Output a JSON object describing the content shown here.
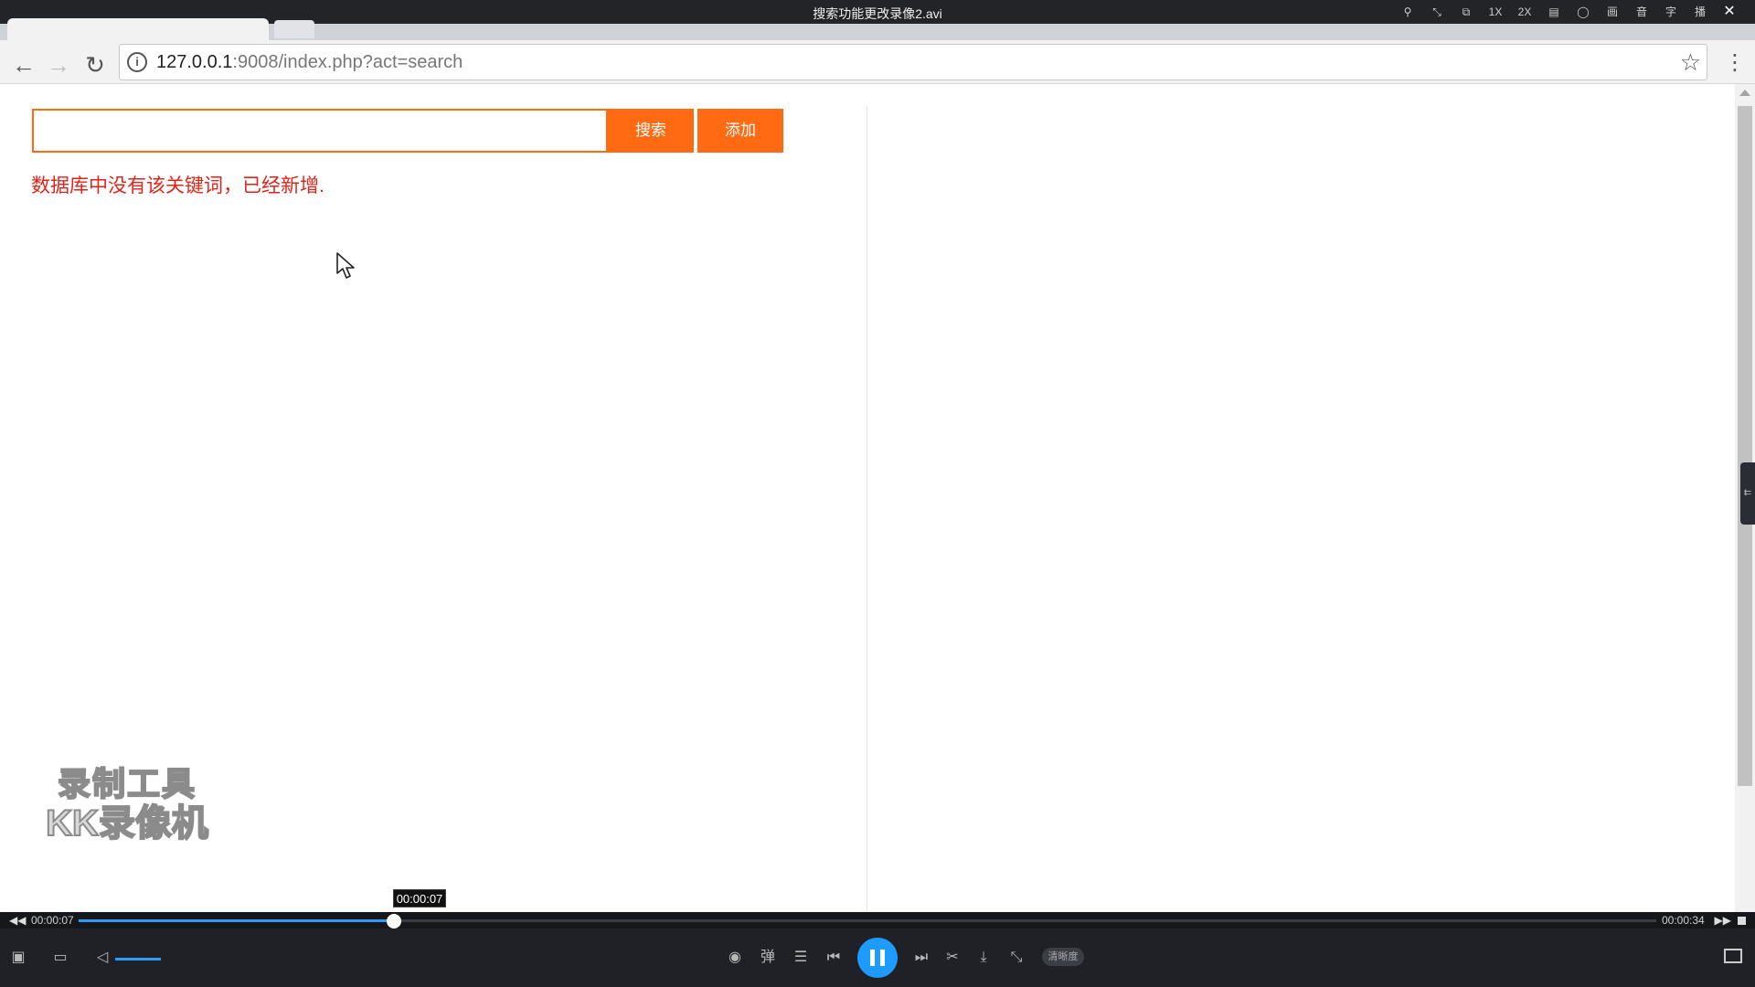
{
  "player": {
    "title": "搜索功能更改录像2.avi",
    "titlebar_icons": [
      {
        "name": "pin-icon",
        "glyph": "⚲"
      },
      {
        "name": "mini-mode-icon",
        "glyph": "⤡"
      },
      {
        "name": "screenshot-icon",
        "glyph": "⧉"
      },
      {
        "name": "speed-1x",
        "glyph": "1X"
      },
      {
        "name": "speed-2x",
        "glyph": "2X"
      },
      {
        "name": "playlist-icon",
        "glyph": "▤"
      },
      {
        "name": "light-icon",
        "glyph": "◯"
      },
      {
        "name": "picture-menu",
        "glyph": "画"
      },
      {
        "name": "audio-menu",
        "glyph": "音"
      },
      {
        "name": "subtitle-menu",
        "glyph": "字"
      },
      {
        "name": "playback-menu",
        "glyph": "播"
      }
    ],
    "close_glyph": "✕",
    "tooltip_time": "00:00:07",
    "current_time": "00:00:07",
    "total_time": "00:00:34",
    "progress_fraction": 0.2,
    "volume_fraction": 1.0,
    "quality_label": "清晰度",
    "danmaku_label": "弹"
  },
  "browser": {
    "url_host": "127.0.0.1",
    "url_rest": ":9008/index.php?act=search",
    "info_glyph": "i",
    "star_glyph": "☆",
    "menu_glyph": "⋮",
    "back_glyph": "←",
    "forward_glyph": "→",
    "reload_glyph": "↻"
  },
  "page": {
    "search_value": "",
    "search_button": "搜索",
    "add_button": "添加",
    "message": "数据库中没有该关键词，已经新增.",
    "message_color": "#e2231a",
    "accent_color": "#ff6a13"
  },
  "watermark": {
    "line1": "录制工具",
    "line2": "KK录像机"
  }
}
